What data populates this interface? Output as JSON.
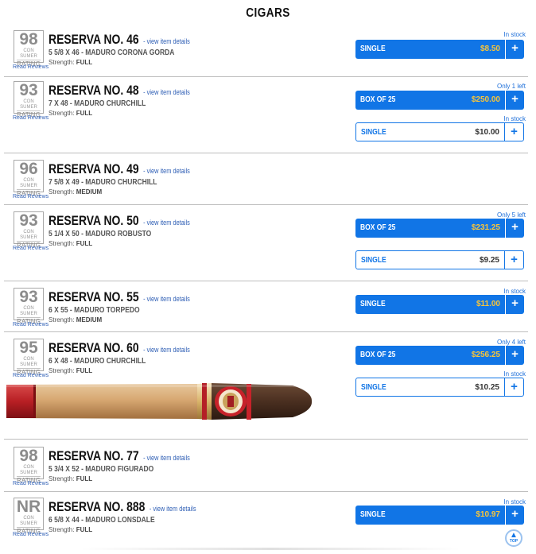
{
  "page": {
    "title": "CIGARS"
  },
  "labels": {
    "consumer": "CON SUMER",
    "rating": "RATING",
    "read_reviews": "Read Reviews",
    "view_details": "- view item details",
    "strength_prefix": "Strength:",
    "plus": "+",
    "top": "TOP"
  },
  "products": [
    {
      "rating": "98",
      "name": "RESERVA NO. 46",
      "desc": "5 5/8 X 46 - MADURO CORONA GORDA",
      "strength": "FULL",
      "options": [
        {
          "stock": "In stock",
          "label": "SINGLE",
          "price": "$8.50",
          "style": "blue"
        }
      ]
    },
    {
      "rating": "93",
      "name": "RESERVA NO. 48",
      "desc": "7 X 48 - MADURO CHURCHILL",
      "strength": "FULL",
      "options": [
        {
          "stock": "Only 1 left",
          "label": "BOX OF 25",
          "price": "$250.00",
          "style": "blue"
        },
        {
          "stock": "In stock",
          "label": "SINGLE",
          "price": "$10.00",
          "style": "white"
        }
      ]
    },
    {
      "rating": "96",
      "name": "RESERVA NO. 49",
      "desc": "7 5/8 X 49 - MADURO CHURCHILL",
      "strength": "MEDIUM",
      "options": []
    },
    {
      "rating": "93",
      "name": "RESERVA NO. 50",
      "desc": "5 1/4 X 50 - MADURO ROBUSTO",
      "strength": "FULL",
      "options": [
        {
          "stock": "Only 5 left",
          "label": "BOX OF 25",
          "price": "$231.25",
          "style": "blue"
        },
        {
          "stock": "",
          "label": "SINGLE",
          "price": "$9.25",
          "style": "white"
        }
      ]
    },
    {
      "rating": "93",
      "name": "RESERVA NO. 55",
      "desc": "6 X 55 - MADURO TORPEDO",
      "strength": "MEDIUM",
      "options": [
        {
          "stock": "In stock",
          "label": "SINGLE",
          "price": "$11.00",
          "style": "blue"
        }
      ]
    },
    {
      "rating": "95",
      "name": "RESERVA NO. 60",
      "desc": "6 X 48 - MADURO CHURCHILL",
      "strength": "FULL",
      "options": [
        {
          "stock": "Only 4 left",
          "label": "BOX OF 25",
          "price": "$256.25",
          "style": "blue"
        },
        {
          "stock": "In stock",
          "label": "SINGLE",
          "price": "$10.25",
          "style": "white"
        }
      ]
    },
    {
      "rating": "98",
      "name": "RESERVA NO. 77",
      "desc": "5 3/4 X 52 - MADURO FIGURADO",
      "strength": "FULL",
      "options": []
    },
    {
      "rating": "NR",
      "name": "RESERVA NO. 888",
      "desc": "6 5/8 X 44 - MADURO LONSDALE",
      "strength": "FULL",
      "options": [
        {
          "stock": "In stock",
          "label": "SINGLE",
          "price": "$10.97",
          "style": "blue"
        }
      ]
    }
  ],
  "colors": {
    "accent": "#1175e6",
    "price_highlight": "#f8c53a",
    "link": "#2f5fb5"
  }
}
